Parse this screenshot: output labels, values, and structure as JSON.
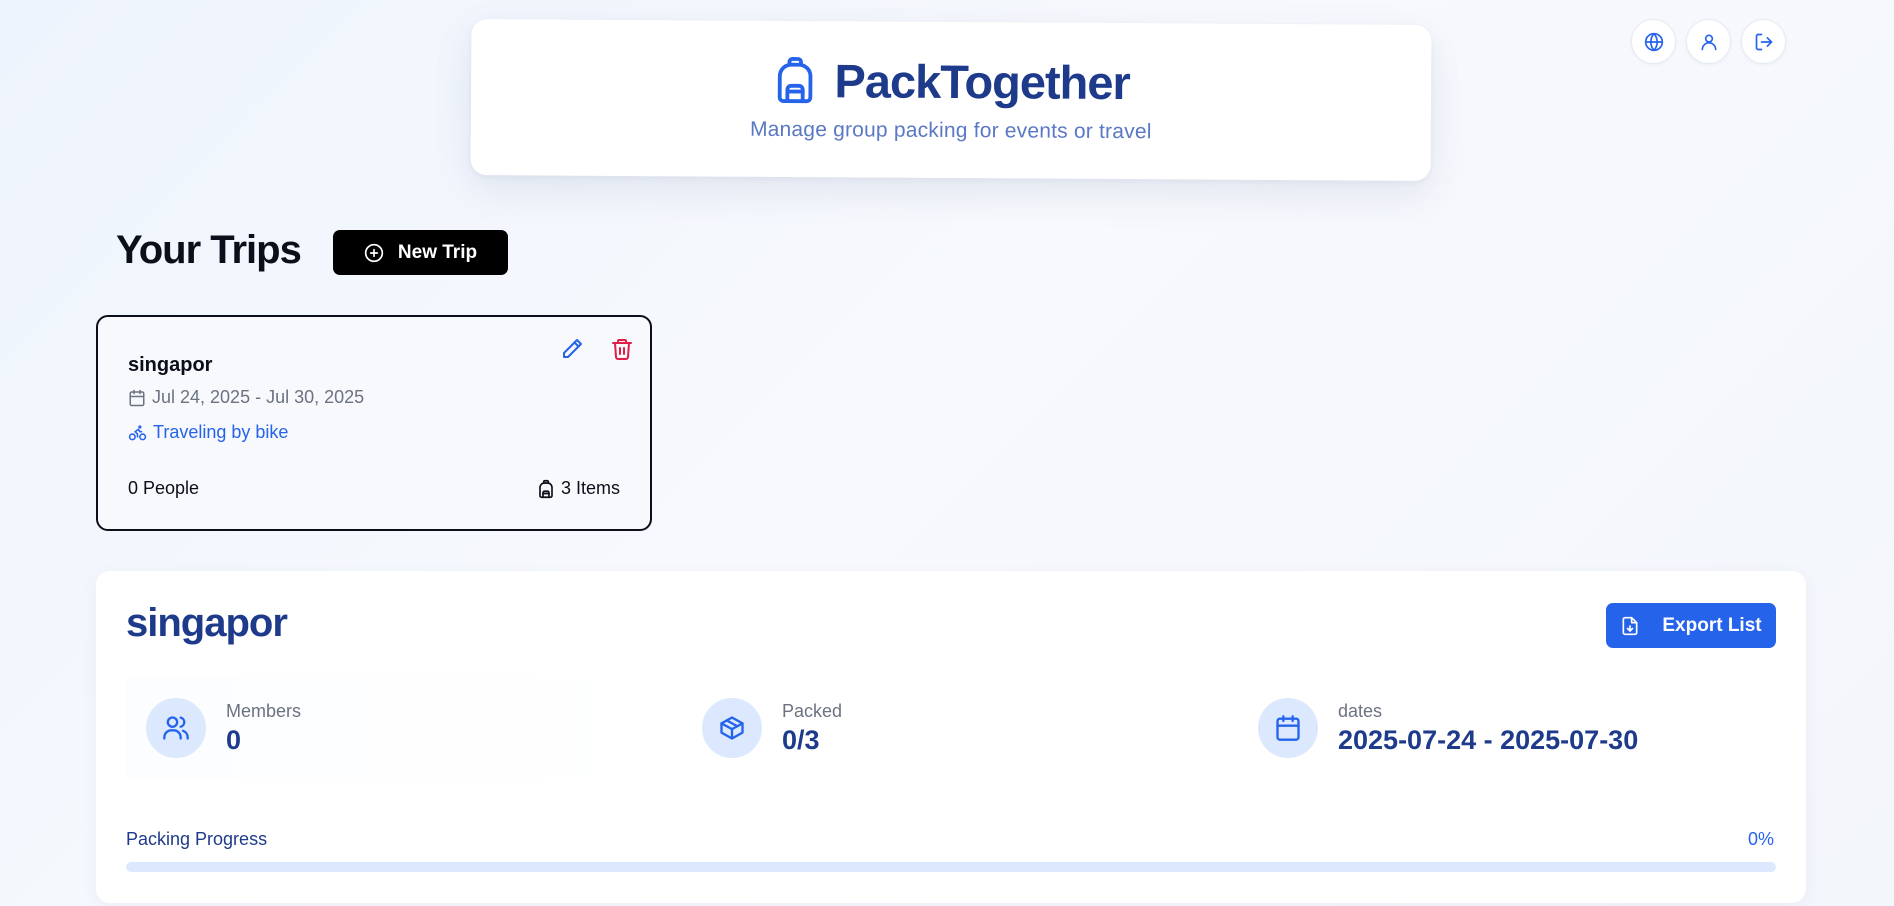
{
  "header": {
    "app_name": "PackTogether",
    "tagline": "Manage group packing for events or travel",
    "logo_icon": "backpack-icon"
  },
  "top_actions": [
    {
      "icon": "globe-icon"
    },
    {
      "icon": "user-icon"
    },
    {
      "icon": "logout-icon"
    }
  ],
  "trips_section": {
    "title": "Your Trips",
    "new_trip_label": "New Trip"
  },
  "trips": [
    {
      "name": "singapor",
      "date_range": "Jul 24, 2025 - Jul 30, 2025",
      "travel_mode": "Traveling by bike",
      "people": "0 People",
      "items": "3 Items"
    }
  ],
  "detail": {
    "title": "singapor",
    "export_label": "Export List",
    "stats": {
      "members": {
        "label": "Members",
        "value": "0"
      },
      "packed": {
        "label": "Packed",
        "value": "0/3"
      },
      "dates": {
        "label": "dates",
        "value": "2025-07-24 - 2025-07-30"
      }
    },
    "progress": {
      "label": "Packing Progress",
      "percent_text": "0%",
      "percent": 0
    }
  },
  "colors": {
    "primary": "#2563eb",
    "heading": "#1e3a8a",
    "danger": "#e11d48",
    "accent_light": "#dbe8fd"
  }
}
